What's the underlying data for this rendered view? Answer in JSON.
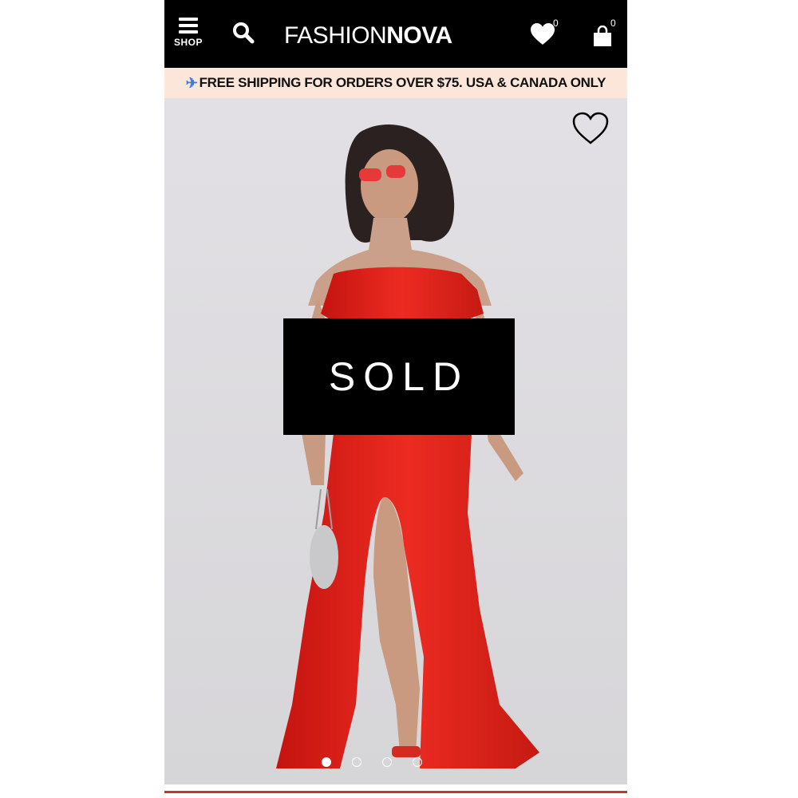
{
  "header": {
    "shop_label": "SHOP",
    "logo_thin": "FASHION",
    "logo_bold": "NOVA",
    "wishlist_count": "0",
    "cart_count": "0"
  },
  "banner": {
    "icon": "airplane-icon",
    "text": "FREE SHIPPING FOR ORDERS OVER $75. USA & CANADA ONLY"
  },
  "product": {
    "status_label": "SOLD",
    "image_dots": [
      {
        "active": true
      },
      {
        "active": false
      },
      {
        "active": false
      },
      {
        "active": false
      }
    ]
  },
  "colors": {
    "header_bg": "#000000",
    "banner_bg": "#fbe6d9",
    "dress_red": "#e3231e",
    "accent_line": "#c0392b"
  }
}
